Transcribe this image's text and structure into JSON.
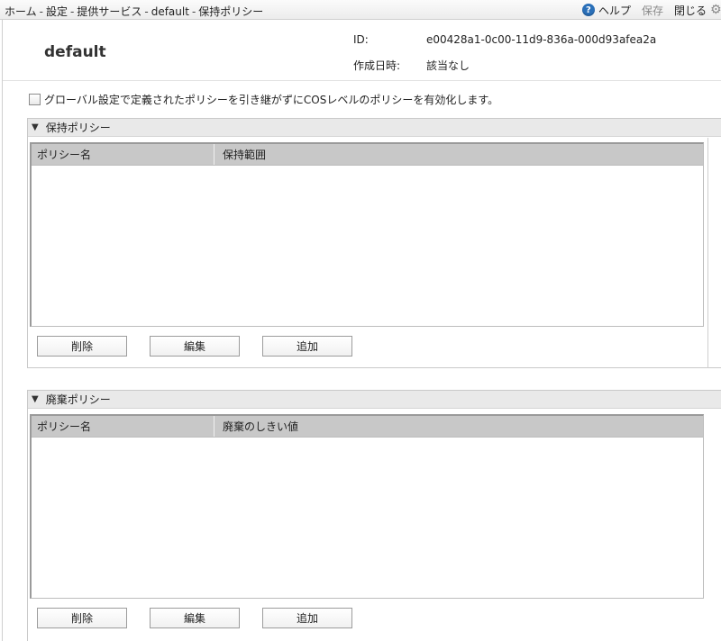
{
  "breadcrumb": {
    "items": [
      "ホーム",
      "設定",
      "提供サービス",
      "default",
      "保持ポリシー"
    ],
    "separator": "-"
  },
  "title_actions": {
    "help": "ヘルプ",
    "save": "保存",
    "close": "閉じる",
    "help_icon": "?",
    "gear_icon": "⚙"
  },
  "header": {
    "name": "default",
    "id_label": "ID:",
    "id_value": "e00428a1-0c00-11d9-836a-000d93afea2a",
    "created_label": "作成日時:",
    "created_value": "該当なし"
  },
  "option": {
    "checked": false,
    "label": "グローバル設定で定義されたポリシーを引き継がずにCOSレベルのポリシーを有効化します。"
  },
  "retention_panel": {
    "title": "保持ポリシー",
    "columns": [
      "ポリシー名",
      "保持範囲"
    ],
    "rows": [],
    "buttons": {
      "delete": "削除",
      "edit": "編集",
      "add": "追加"
    }
  },
  "purge_panel": {
    "title": "廃棄ポリシー",
    "columns": [
      "ポリシー名",
      "廃棄のしきい値"
    ],
    "rows": [],
    "buttons": {
      "delete": "削除",
      "edit": "編集",
      "add": "追加"
    }
  },
  "icons": {
    "collapse": "▼"
  }
}
